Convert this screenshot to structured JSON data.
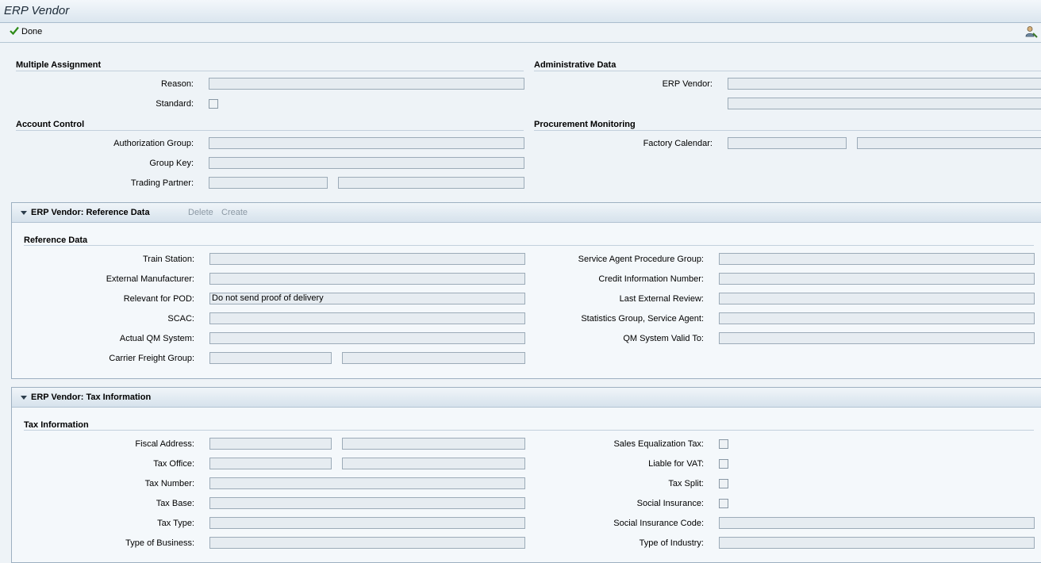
{
  "window": {
    "title": "ERP Vendor"
  },
  "toolbar": {
    "done_label": "Done"
  },
  "multiple_assignment": {
    "header": "Multiple Assignment",
    "reason_label": "Reason:",
    "reason_value": "",
    "standard_label": "Standard:"
  },
  "account_control": {
    "header": "Account Control",
    "authorization_group_label": "Authorization Group:",
    "group_key_label": "Group Key:",
    "trading_partner_label": "Trading Partner:"
  },
  "administrative_data": {
    "header": "Administrative Data",
    "erp_vendor_label": "ERP Vendor:"
  },
  "procurement_monitoring": {
    "header": "Procurement Monitoring",
    "factory_calendar_label": "Factory Calendar:"
  },
  "reference_tray": {
    "title": "ERP Vendor: Reference Data",
    "delete_label": "Delete",
    "create_label": "Create",
    "section_header": "Reference Data",
    "left_labels": {
      "train_station": "Train Station:",
      "external_manufacturer": "External Manufacturer:",
      "relevant_for_pod": "Relevant for POD:",
      "scac": "SCAC:",
      "actual_qm_system": "Actual QM System:",
      "carrier_freight_group": "Carrier Freight Group:"
    },
    "relevant_for_pod_value": "Do not send proof of delivery",
    "right_labels": {
      "service_agent_procedure_group": "Service Agent Procedure Group:",
      "credit_information_number": "Credit Information Number:",
      "last_external_review": "Last External Review:",
      "statistics_group": "Statistics Group, Service Agent:",
      "qm_system_valid_to": "QM System Valid To:"
    }
  },
  "tax_tray": {
    "title": "ERP Vendor: Tax Information",
    "section_header": "Tax Information",
    "left_labels": {
      "fiscal_address": "Fiscal Address:",
      "tax_office": "Tax Office:",
      "tax_number": "Tax Number:",
      "tax_base": "Tax Base:",
      "tax_type": "Tax Type:",
      "type_of_business": "Type of Business:"
    },
    "right_labels": {
      "sales_equalization_tax": "Sales Equalization Tax:",
      "liable_for_vat": "Liable for VAT:",
      "tax_split": "Tax Split:",
      "social_insurance": "Social Insurance:",
      "social_insurance_code": "Social Insurance Code:",
      "type_of_industry": "Type of Industry:"
    }
  },
  "colors": {
    "accent": "#2d8a16",
    "field_bg": "#e6ecf1",
    "page_bg": "#eef3f7"
  },
  "icons": {
    "done": "checkmark-icon",
    "personalize": "person-settings-icon",
    "collapse": "triangle-down-icon"
  }
}
